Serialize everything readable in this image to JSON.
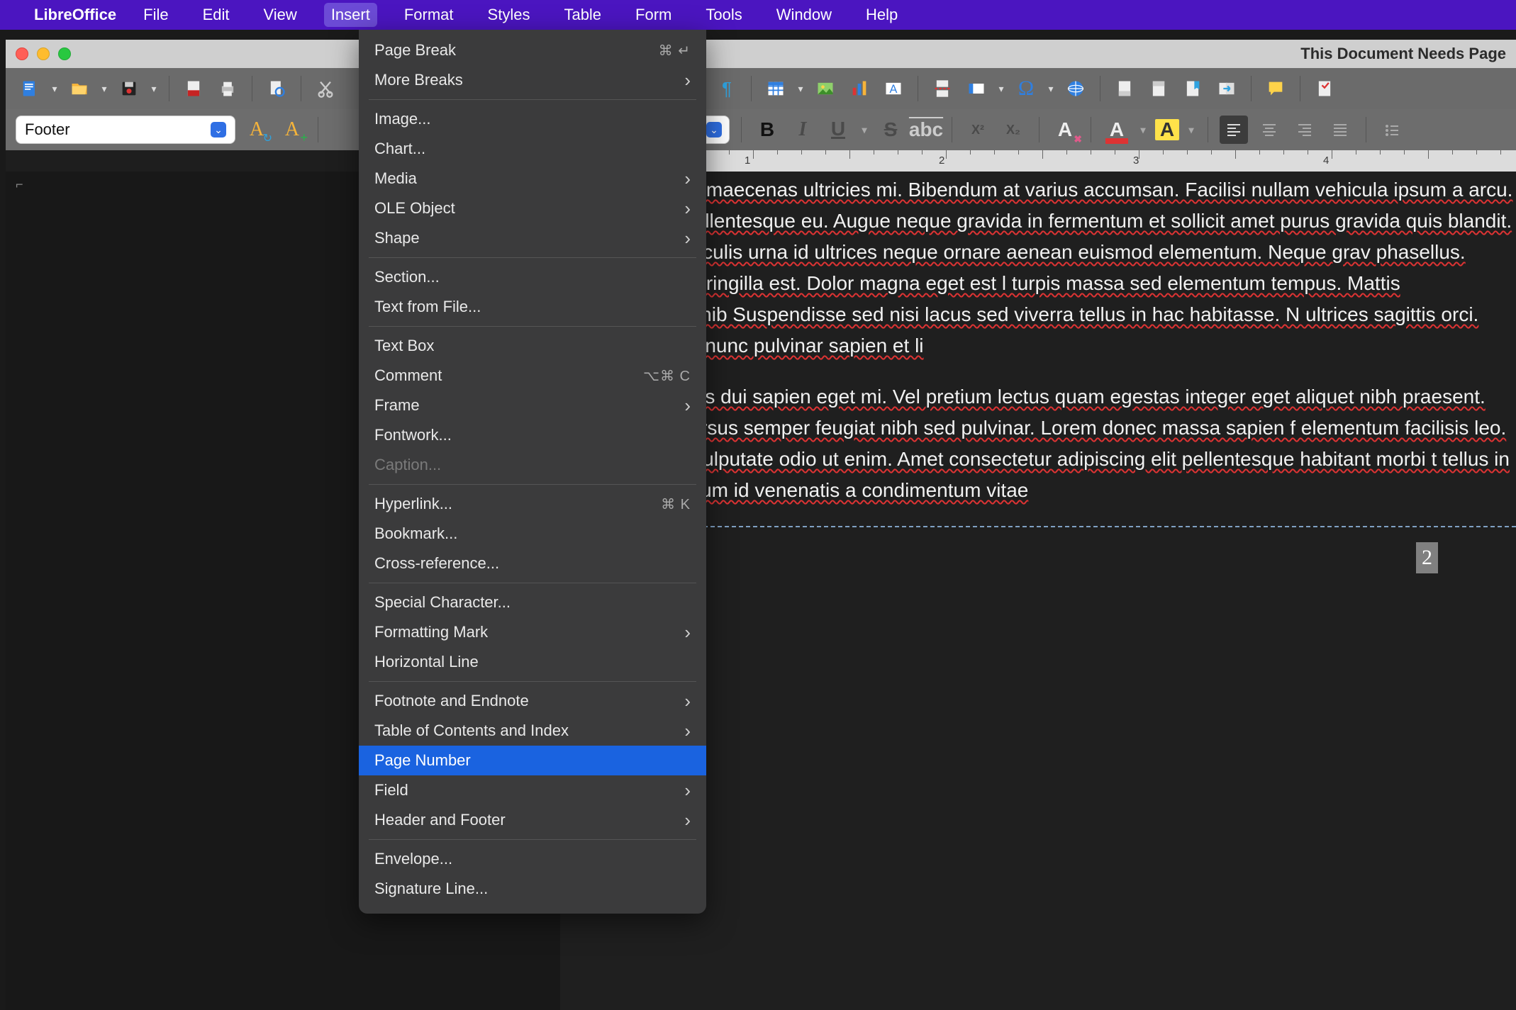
{
  "menubar": {
    "appname": "LibreOffice",
    "items": [
      "File",
      "Edit",
      "View",
      "Insert",
      "Format",
      "Styles",
      "Table",
      "Form",
      "Tools",
      "Window",
      "Help"
    ],
    "active_index": 3
  },
  "window": {
    "title": "This Document Needs Page"
  },
  "style_dropdown": {
    "value": "Footer"
  },
  "ruler": {
    "numbers": [
      "1",
      "2",
      "3",
      "4"
    ]
  },
  "insert_menu": {
    "groups": [
      [
        {
          "label": "Page Break",
          "shortcut": "⌘ ↵"
        },
        {
          "label": "More Breaks",
          "sub": true
        }
      ],
      [
        {
          "label": "Image..."
        },
        {
          "label": "Chart..."
        },
        {
          "label": "Media",
          "sub": true
        },
        {
          "label": "OLE Object",
          "sub": true
        },
        {
          "label": "Shape",
          "sub": true
        }
      ],
      [
        {
          "label": "Section..."
        },
        {
          "label": "Text from File..."
        }
      ],
      [
        {
          "label": "Text Box"
        },
        {
          "label": "Comment",
          "shortcut": "⌥⌘ C"
        },
        {
          "label": "Frame",
          "sub": true
        },
        {
          "label": "Fontwork..."
        },
        {
          "label": "Caption...",
          "disabled": true
        }
      ],
      [
        {
          "label": "Hyperlink...",
          "shortcut": "⌘ K"
        },
        {
          "label": "Bookmark..."
        },
        {
          "label": "Cross-reference..."
        }
      ],
      [
        {
          "label": "Special Character..."
        },
        {
          "label": "Formatting Mark",
          "sub": true
        },
        {
          "label": "Horizontal Line"
        }
      ],
      [
        {
          "label": "Footnote and Endnote",
          "sub": true
        },
        {
          "label": "Table of Contents and Index",
          "sub": true
        },
        {
          "label": "Page Number",
          "highlight": true
        },
        {
          "label": "Field",
          "sub": true
        },
        {
          "label": "Header and Footer",
          "sub": true
        }
      ],
      [
        {
          "label": "Envelope..."
        },
        {
          "label": "Signature Line..."
        }
      ]
    ]
  },
  "document": {
    "para1": "aliquam id diam maecenas ultricies mi. Bibendum at varius accumsan. Facilisi nullam vehicula ipsum a arcu. Orci phasellu pellentesque eu. Augue neque gravida in fermentum et sollicit amet purus gravida quis blandit. Morbi tempus iaculis urna id ultrices neque ornare aenean euismod elementum. Neque grav phasellus. Facilisis leo vel fringilla est. Dolor magna eget est l turpis massa sed elementum tempus. Mattis pellentesque id nib Suspendisse sed nisi lacus sed viverra tellus in hac habitasse. N ultrices sagittis orci. Massa tincidunt nunc pulvinar sapien et li",
    "para2": "Justo nec ultrices dui sapien eget mi. Vel pretium lectus quam egestas integer eget aliquet nibh praesent. Urna nunc id cursus semper feugiat nibh sed pulvinar. Lorem donec massa sapien f elementum facilisis leo. Quis risus sed vulputate odio ut enim. Amet consectetur adipiscing elit pellentesque habitant morbi t tellus in hac. Condimentum id venenatis a condimentum vitae",
    "footer_page": "2"
  },
  "format_buttons": {
    "bold": "B",
    "italic": "I",
    "underline": "U",
    "strike": "S",
    "super": "X²",
    "sub": "X₂",
    "fontA": "A",
    "highlightA": "A",
    "charA": "A"
  }
}
